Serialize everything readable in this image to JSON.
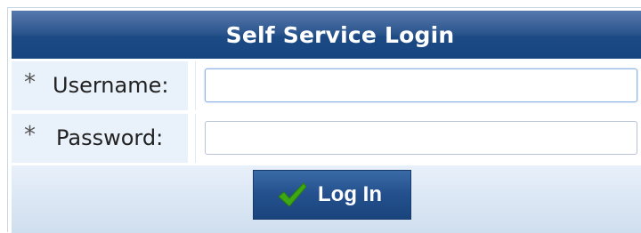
{
  "form": {
    "title": "Self Service Login",
    "required_marker": "*",
    "fields": [
      {
        "label": "Username:",
        "value": "",
        "placeholder": ""
      },
      {
        "label": "Password:",
        "value": "",
        "placeholder": ""
      }
    ],
    "submit_label": "Log In",
    "submit_icon": "checkmark-icon"
  },
  "colors": {
    "header": "#1c4a84",
    "label_cell": "#e9f1fa",
    "button": "#23508d",
    "check": "#3ea814"
  }
}
